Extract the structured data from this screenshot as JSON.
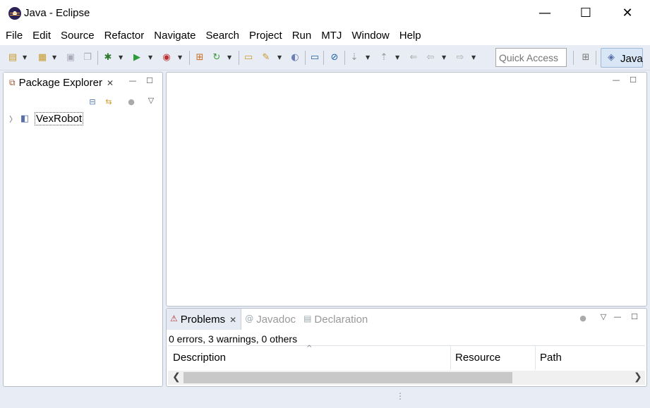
{
  "window": {
    "title": "Java - Eclipse",
    "minimize_glyph": "—",
    "maximize_glyph": "☐",
    "close_glyph": "✕"
  },
  "menu": [
    "File",
    "Edit",
    "Source",
    "Refactor",
    "Navigate",
    "Search",
    "Project",
    "Run",
    "MTJ",
    "Window",
    "Help"
  ],
  "toolbar": {
    "quick_access_placeholder": "Quick Access",
    "perspective_label": "Java",
    "icons": [
      "new-icon",
      "new-package-icon",
      "save-icon",
      "save-all-icon",
      "debug-icon",
      "run-icon",
      "run-external-icon",
      "new-class-icon",
      "refresh-icon",
      "open-type-icon",
      "search-icon",
      "open-task-icon",
      "console-icon",
      "skip-breakpoints-icon",
      "next-annotation-icon",
      "previous-annotation-icon",
      "back-icon",
      "forward-icon",
      "open-perspective-icon"
    ]
  },
  "package_explorer": {
    "tab_label": "Package Explorer",
    "projects": [
      {
        "name": "VexRobot"
      }
    ]
  },
  "bottom_panel": {
    "tabs": [
      {
        "label": "Problems",
        "active": true
      },
      {
        "label": "Javadoc",
        "active": false
      },
      {
        "label": "Declaration",
        "active": false
      }
    ],
    "summary": "0 errors, 3 warnings, 0 others",
    "columns": [
      "Description",
      "Resource",
      "Path"
    ]
  },
  "colors": {
    "chrome_bg": "#e8ecf4",
    "active_perspective": "#d8e6f5",
    "run_green": "#2a9a3a"
  }
}
